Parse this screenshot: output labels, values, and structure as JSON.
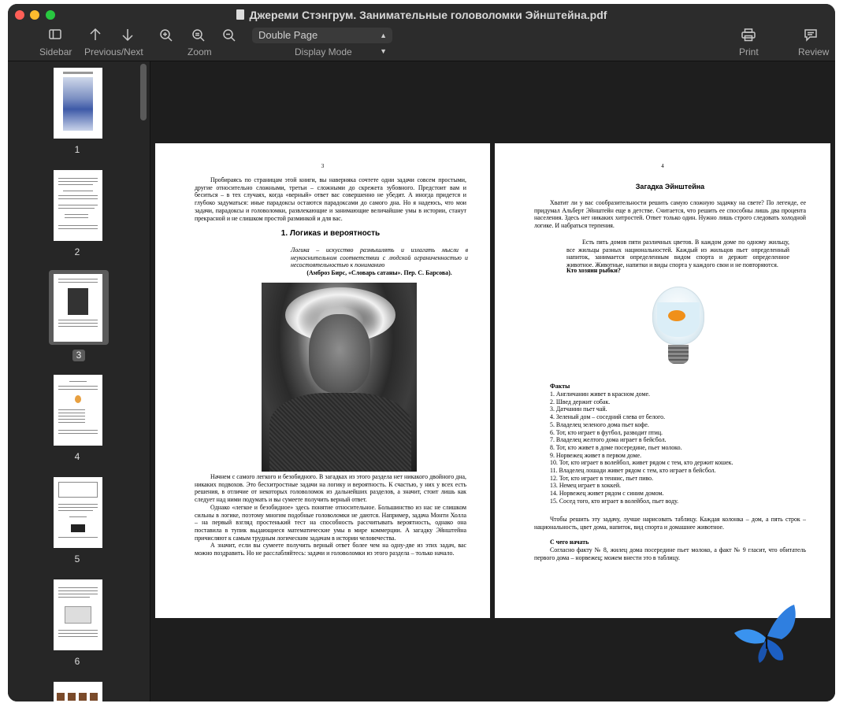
{
  "window": {
    "title": "Джереми Стэнгрум. Занимательные головоломки Эйнштейна.pdf"
  },
  "toolbar": {
    "sidebar_label": "Sidebar",
    "prevnext_label": "Previous/Next",
    "zoom_label": "Zoom",
    "display_mode_label": "Display Mode",
    "display_mode_value": "Double Page",
    "print_label": "Print",
    "review_label": "Review"
  },
  "sidebar": {
    "thumbnails": [
      {
        "label": "1",
        "selected": false
      },
      {
        "label": "2",
        "selected": false
      },
      {
        "label": "3",
        "selected": true
      },
      {
        "label": "4",
        "selected": false
      },
      {
        "label": "5",
        "selected": false
      },
      {
        "label": "6",
        "selected": false
      }
    ]
  },
  "left_page": {
    "page_number": "3",
    "intro": "Пробираясь по страницам этой книги, вы наверняка сочтете одни задачи совсем простыми, другие относительно сложными, третьи – сложными до скрежета зубовного. Предстоит вам и беситься – в тех случаях, когда «верный» ответ вас совершенно не убедит. А иногда придется и глубоко задуматься: иные парадоксы остаются парадоксами до самого дна. Но я надеюсь, что мои задачи, парадоксы и головоломки, развлекающие и занимающие величайшие умы в истории, станут прекрасной и не слишком простой разминкой и для вас.",
    "section_title": "1. Логикаs и вероятность",
    "epigraph": "Логика – искусство размышлять и излагать мысли в неукоснительном соответствии с людской ограниченностью и несостоятельностью к пониманию",
    "epigraph_source": "(Амброз Бирс, «Словарь сатаны». Пер. С. Барсова).",
    "para1": "Начнем с самого легкого и безобидного. В загадках из этого раздела нет никакого двойного дна, никаких подвохов. Это бесхитростные задачи на логику и вероятность. К счастью, у них у всех есть решения, в отличие от некоторых головоломок из дальнейших разделов, а значит, стоит лишь как следует над ними подумать и вы сумеете получить верный ответ.",
    "para2": "Однако «легкое и безобидное» здесь понятие относительное. Большинство из нас не слишком сильны в логике, поэтому многим подобные головоломки не даются. Например, задача Монти Холла – на первый взгляд простенький тест на способность рассчитывать вероятность, однако она поставила в тупик выдающиеся математические умы в мире коммерции. А загадку Эйнштейна причисляют к самым трудным логическим задачам в истории человечества.",
    "para3": "А значит, если вы сумеете получить верный ответ более чем на одну-две из этих задач, вас можно поздравить. Но не расслабляйтесь: задачи и головоломки из этого раздела – только начало."
  },
  "right_page": {
    "page_number": "4",
    "title": "Загадка Эйнштейна",
    "intro": "Хватит ли у вас сообразительности решить самую сложную задачку на свете? По легенде, ее придумал Альберт Эйнштейн еще в детстве. Считается, что решить ее способны лишь два процента населения. Здесь нет никаких хитростей. Ответ только один. Нужно лишь строго следовать холодной логике. И набраться терпения.",
    "quote": "Есть пять домов пяти различных цветов. В каждом доме по одному жильцу, все жильцы разных национальностей. Каждый из жильцов пьет определенный напиток, занимается определенным видом спорта и держит определенное животное. Животные, напитки и виды спорта у каждого свои и не повторяются.",
    "question": "Кто хозяин рыбки?",
    "facts_title": "Факты",
    "facts": [
      "1. Англичанин живет в красном доме.",
      "2. Швед держит собак.",
      "3. Датчанин пьет чай.",
      "4. Зеленый дом – соседний слева от белого.",
      "5. Владелец зеленого дома пьет кофе.",
      "6. Тот, кто играет в футбол, разводит птиц.",
      "7. Владелец желтого дома играет в бейсбол.",
      "8. Тот, кто живет в доме посередине, пьет молоко.",
      "9. Норвежец живет в первом доме.",
      "10. Тот, кто играет в волейбол, живет рядом с тем, кто держит кошек.",
      "11. Владелец лошади живет рядом с тем, кто играет в бейсбол.",
      "12. Тот, кто играет в теннис, пьет пиво.",
      "13. Немец играет в хоккей.",
      "14. Норвежец живет рядом с синим домом.",
      "15. Сосед того, кто играет в волейбол, пьет воду."
    ],
    "after_facts": "Чтобы решить эту задачу, лучше нарисовать таблицу. Каждая колонка – дом, а пять строк – национальность, цвет дома, напиток, вид спорта и домашнее животное.",
    "start_title": "С чего начать",
    "start_text": "Согласно факту № 8, жилец дома посередине пьет молоко, а факт № 9 гласит, что обитатель первого дома – норвежец; можем внести это в таблицу."
  }
}
